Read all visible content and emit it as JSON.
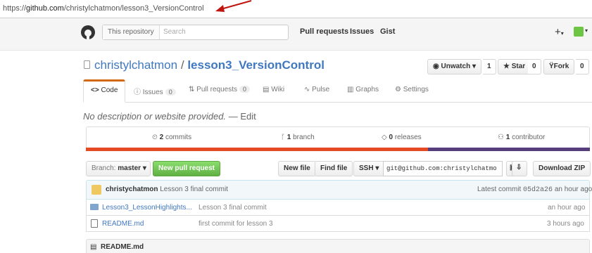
{
  "browser": {
    "url_scheme": "https://",
    "url_host": "github.com",
    "url_path": "/christylchatmon/lesson3_VersionControl"
  },
  "header": {
    "search_scope": "This repository",
    "search_placeholder": "Search",
    "nav": [
      "Pull requests",
      "Issues",
      "Gist"
    ],
    "plus": "+"
  },
  "repo": {
    "owner": "christylchatmon",
    "separator": "/",
    "name": "lesson3_VersionControl"
  },
  "actions": {
    "unwatch": "Unwatch",
    "unwatch_count": "1",
    "star": "Star",
    "star_count": "0",
    "fork": "Fork",
    "fork_count": "0"
  },
  "tabs": [
    {
      "label": "Code",
      "icon": "code-icon"
    },
    {
      "label": "Issues",
      "badge": "0",
      "icon": "issue-icon"
    },
    {
      "label": "Pull requests",
      "badge": "0",
      "icon": "pull-request-icon"
    },
    {
      "label": "Wiki",
      "icon": "book-icon"
    },
    {
      "label": "Pulse",
      "icon": "pulse-icon"
    },
    {
      "label": "Graphs",
      "icon": "graph-icon"
    },
    {
      "label": "Settings",
      "icon": "gear-icon"
    }
  ],
  "description": {
    "text": "No description or website provided.",
    "dash": "—",
    "edit": "Edit"
  },
  "summary": {
    "commits_num": "2",
    "commits_label": "commits",
    "branch_num": "1",
    "branch_label": "branch",
    "releases_num": "0",
    "releases_label": "releases",
    "contributor_num": "1",
    "contributor_label": "contributor"
  },
  "file_nav": {
    "branch_label": "Branch:",
    "branch_value": "master",
    "new_pr": "New pull request",
    "new_file": "New file",
    "find_file": "Find file",
    "ssh": "SSH",
    "clone_url": "git@github.com:christylchatmo",
    "download_zip": "Download ZIP"
  },
  "latest_commit": {
    "author": "christychatmon",
    "message": "Lesson 3 final commit",
    "prefix": "Latest commit",
    "sha": "05d2a26",
    "age": "an hour ago"
  },
  "files": [
    {
      "name": "Lesson3_LessonHighlights...",
      "type": "folder",
      "message": "Lesson 3 final commit",
      "age": "an hour ago"
    },
    {
      "name": "README.md",
      "type": "file",
      "message": "first commit for lesson 3",
      "age": "3 hours ago"
    }
  ],
  "readme": {
    "title": "README.md"
  },
  "colors": {
    "link": "#4078c0",
    "accent_tab": "#d26911",
    "green": "#6cc644",
    "lang_orange": "#e44b23",
    "lang_purple": "#563d7c"
  }
}
